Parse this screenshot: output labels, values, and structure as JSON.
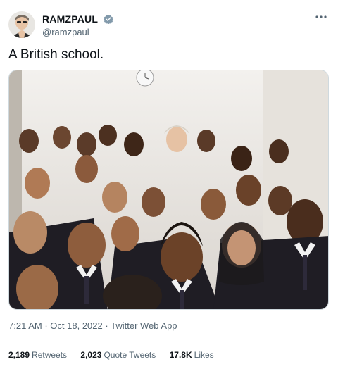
{
  "author": {
    "display_name": "RAMZPAUL",
    "handle": "@ramzpaul",
    "verified": true,
    "avatar_icon": "profile-photo"
  },
  "more_icon": "ellipsis-icon",
  "tweet": {
    "text": "A British school.",
    "media_description_icon": "group-photo"
  },
  "meta": {
    "time": "7:21 AM",
    "separator1": "·",
    "date": "Oct 18, 2022",
    "separator2": "·",
    "source": "Twitter Web App"
  },
  "stats": {
    "retweets_count": "2,189",
    "retweets_label": "Retweets",
    "quotes_count": "2,023",
    "quotes_label": "Quote Tweets",
    "likes_count": "17.8K",
    "likes_label": "Likes"
  },
  "colors": {
    "verified": "#1d9bf0",
    "secondary_text": "#536471",
    "primary_text": "#0f1419",
    "border": "#cfd9de"
  }
}
